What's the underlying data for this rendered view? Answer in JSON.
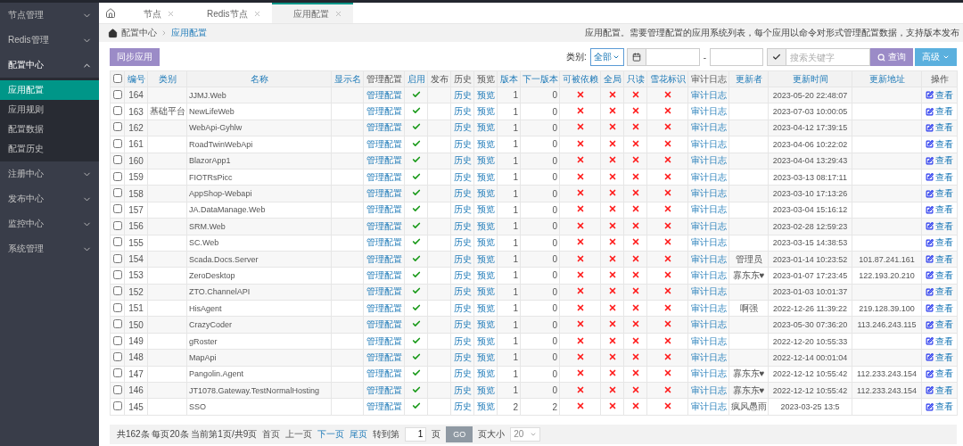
{
  "sidebar": {
    "items": [
      {
        "label": "节点管理",
        "expanded": false
      },
      {
        "label": "Redis管理",
        "expanded": false
      },
      {
        "label": "配置中心",
        "expanded": true,
        "children": [
          {
            "label": "应用配置",
            "selected": true
          },
          {
            "label": "应用规则",
            "selected": false
          },
          {
            "label": "配置数据",
            "selected": false
          },
          {
            "label": "配置历史",
            "selected": false
          }
        ]
      },
      {
        "label": "注册中心",
        "expanded": false
      },
      {
        "label": "发布中心",
        "expanded": false
      },
      {
        "label": "监控中心",
        "expanded": false
      },
      {
        "label": "系统管理",
        "expanded": false
      }
    ]
  },
  "tabs": [
    {
      "label": "节点",
      "selected": false
    },
    {
      "label": "Redis节点",
      "selected": false
    },
    {
      "label": "应用配置",
      "selected": true
    }
  ],
  "breadcrumb": {
    "items": [
      "配置中心",
      "应用配置"
    ],
    "description": "应用配置。需要管理配置的应用系统列表，每个应用以命令对形式管理配置数据，支持版本发布"
  },
  "toolbar": {
    "sync_button": "同步应用",
    "category_label": "类别:",
    "category_value": "全部",
    "date_separator": "-",
    "search_placeholder": "搜索关键字",
    "search_button": "查询",
    "advanced_button": "高级"
  },
  "table": {
    "select_all_checked": false,
    "columns": [
      {
        "label": "编号",
        "sortable": true
      },
      {
        "label": "类别",
        "sortable": true
      },
      {
        "label": "名称",
        "sortable": true
      },
      {
        "label": "显示名",
        "sortable": true
      },
      {
        "label": "管理配置",
        "sortable": false
      },
      {
        "label": "启用",
        "sortable": true
      },
      {
        "label": "发布",
        "sortable": false
      },
      {
        "label": "历史",
        "sortable": false
      },
      {
        "label": "预览",
        "sortable": false
      },
      {
        "label": "版本",
        "sortable": true
      },
      {
        "label": "下一版本",
        "sortable": true
      },
      {
        "label": "可被依赖",
        "sortable": true
      },
      {
        "label": "全局",
        "sortable": true
      },
      {
        "label": "只读",
        "sortable": true
      },
      {
        "label": "雪花标识",
        "sortable": true
      },
      {
        "label": "审计日志",
        "sortable": false
      },
      {
        "label": "更新者",
        "sortable": true
      },
      {
        "label": "更新时间",
        "sortable": true
      },
      {
        "label": "更新地址",
        "sortable": true
      },
      {
        "label": "操作",
        "sortable": false
      }
    ],
    "rows": [
      {
        "checked": false,
        "id": "164",
        "name": "JJMJ.Web",
        "manage": "管理配置",
        "enabled": true,
        "history": "历史",
        "preview": "预览",
        "version": "1",
        "next_version": "0",
        "dependable": false,
        "global": false,
        "readonly": false,
        "snowflake": false,
        "audit": "审计日志",
        "updated_at": "2023-05-20 22:48:07",
        "action": "查看"
      },
      {
        "checked": false,
        "id": "163",
        "category": "基础平台",
        "name": "NewLifeWeb",
        "manage": "管理配置",
        "enabled": true,
        "history": "历史",
        "preview": "预览",
        "version": "1",
        "next_version": "0",
        "dependable": false,
        "global": false,
        "readonly": false,
        "snowflake": false,
        "audit": "审计日志",
        "updated_at": "2023-07-03 10:00:05",
        "action": "查看"
      },
      {
        "checked": false,
        "id": "162",
        "name": "WebApi-Gyhlw",
        "manage": "管理配置",
        "enabled": true,
        "history": "历史",
        "preview": "预览",
        "version": "1",
        "next_version": "0",
        "dependable": false,
        "global": false,
        "readonly": false,
        "snowflake": false,
        "audit": "审计日志",
        "updated_at": "2023-04-12 17:39:15",
        "action": "查看"
      },
      {
        "checked": false,
        "id": "161",
        "name": "RoadTwinWebApi",
        "manage": "管理配置",
        "enabled": true,
        "history": "历史",
        "preview": "预览",
        "version": "1",
        "next_version": "0",
        "dependable": false,
        "global": false,
        "readonly": false,
        "snowflake": false,
        "audit": "审计日志",
        "updated_at": "2023-04-06 10:22:02",
        "action": "查看"
      },
      {
        "checked": false,
        "id": "160",
        "name": "BlazorApp1",
        "manage": "管理配置",
        "enabled": true,
        "history": "历史",
        "preview": "预览",
        "version": "1",
        "next_version": "0",
        "dependable": false,
        "global": false,
        "readonly": false,
        "snowflake": false,
        "audit": "审计日志",
        "updated_at": "2023-04-04 13:29:43",
        "action": "查看"
      },
      {
        "checked": false,
        "id": "159",
        "name": "FIOTRsPicc",
        "manage": "管理配置",
        "enabled": true,
        "history": "历史",
        "preview": "预览",
        "version": "1",
        "next_version": "0",
        "dependable": false,
        "global": false,
        "readonly": false,
        "snowflake": false,
        "audit": "审计日志",
        "updated_at": "2023-03-13 08:17:11",
        "action": "查看"
      },
      {
        "checked": false,
        "id": "158",
        "name": "AppShop-Webapi",
        "manage": "管理配置",
        "enabled": true,
        "history": "历史",
        "preview": "预览",
        "version": "1",
        "next_version": "0",
        "dependable": false,
        "global": false,
        "readonly": false,
        "snowflake": false,
        "audit": "审计日志",
        "updated_at": "2023-03-10 17:13:26",
        "action": "查看"
      },
      {
        "checked": false,
        "id": "157",
        "name": "JA.DataManage.Web",
        "manage": "管理配置",
        "enabled": true,
        "history": "历史",
        "preview": "预览",
        "version": "1",
        "next_version": "0",
        "dependable": false,
        "global": false,
        "readonly": false,
        "snowflake": false,
        "audit": "审计日志",
        "updated_at": "2023-03-04 15:16:12",
        "action": "查看"
      },
      {
        "checked": false,
        "id": "156",
        "name": "SRM.Web",
        "manage": "管理配置",
        "enabled": true,
        "history": "历史",
        "preview": "预览",
        "version": "1",
        "next_version": "0",
        "dependable": false,
        "global": false,
        "readonly": false,
        "snowflake": false,
        "audit": "审计日志",
        "updated_at": "2023-02-28 12:59:23",
        "action": "查看"
      },
      {
        "checked": false,
        "id": "155",
        "name": "SC.Web",
        "manage": "管理配置",
        "enabled": true,
        "history": "历史",
        "preview": "预览",
        "version": "1",
        "next_version": "0",
        "dependable": false,
        "global": false,
        "readonly": false,
        "snowflake": false,
        "audit": "审计日志",
        "updated_at": "2023-03-15 14:38:53",
        "action": "查看"
      },
      {
        "checked": false,
        "id": "154",
        "name": "Scada.Docs.Server",
        "manage": "管理配置",
        "enabled": true,
        "history": "历史",
        "preview": "预览",
        "version": "1",
        "next_version": "0",
        "dependable": false,
        "global": false,
        "readonly": false,
        "snowflake": false,
        "audit": "审计日志",
        "updater": "管理员",
        "updated_at": "2023-01-14 10:23:52",
        "updated_from": "101.87.241.161",
        "action": "查看"
      },
      {
        "checked": false,
        "id": "153",
        "name": "ZeroDesktop",
        "manage": "管理配置",
        "enabled": true,
        "history": "历史",
        "preview": "预览",
        "version": "1",
        "next_version": "0",
        "dependable": false,
        "global": false,
        "readonly": false,
        "snowflake": false,
        "audit": "审计日志",
        "updater": "寡东东♥",
        "updated_at": "2023-01-07 17:23:45",
        "updated_from": "122.193.20.210",
        "action": "查看"
      },
      {
        "checked": false,
        "id": "152",
        "name": "ZTO.ChannelAPI",
        "manage": "管理配置",
        "enabled": true,
        "history": "历史",
        "preview": "预览",
        "version": "1",
        "next_version": "0",
        "dependable": false,
        "global": false,
        "readonly": false,
        "snowflake": false,
        "audit": "审计日志",
        "updated_at": "2023-01-03 10:01:37",
        "action": "查看"
      },
      {
        "checked": false,
        "id": "151",
        "name": "HisAgent",
        "manage": "管理配置",
        "enabled": true,
        "history": "历史",
        "preview": "预览",
        "version": "1",
        "next_version": "0",
        "dependable": false,
        "global": false,
        "readonly": false,
        "snowflake": false,
        "audit": "审计日志",
        "updater": "啊强",
        "updated_at": "2022-12-26 11:39:22",
        "updated_from": "219.128.39.100",
        "action": "查看"
      },
      {
        "checked": false,
        "id": "150",
        "name": "CrazyCoder",
        "manage": "管理配置",
        "enabled": true,
        "history": "历史",
        "preview": "预览",
        "version": "1",
        "next_version": "0",
        "dependable": false,
        "global": false,
        "readonly": false,
        "snowflake": false,
        "audit": "审计日志",
        "updated_at": "2023-05-30 07:36:20",
        "updated_from": "113.246.243.115",
        "action": "查看"
      },
      {
        "checked": false,
        "id": "149",
        "name": "gRoster",
        "manage": "管理配置",
        "enabled": true,
        "history": "历史",
        "preview": "预览",
        "version": "1",
        "next_version": "0",
        "dependable": false,
        "global": false,
        "readonly": false,
        "snowflake": false,
        "audit": "审计日志",
        "updated_at": "2022-12-20 10:55:33",
        "action": "查看"
      },
      {
        "checked": false,
        "id": "148",
        "name": "MapApi",
        "manage": "管理配置",
        "enabled": true,
        "history": "历史",
        "preview": "预览",
        "version": "1",
        "next_version": "0",
        "dependable": false,
        "global": false,
        "readonly": false,
        "snowflake": false,
        "audit": "审计日志",
        "updated_at": "2022-12-14 00:01:04",
        "action": "查看"
      },
      {
        "checked": false,
        "id": "147",
        "name": "Pangolin.Agent",
        "manage": "管理配置",
        "enabled": true,
        "history": "历史",
        "preview": "预览",
        "version": "1",
        "next_version": "0",
        "dependable": false,
        "global": false,
        "readonly": false,
        "snowflake": false,
        "audit": "审计日志",
        "updater": "寡东东♥",
        "updated_at": "2022-12-12 10:55:42",
        "updated_from": "112.233.243.154",
        "action": "查看"
      },
      {
        "checked": false,
        "id": "146",
        "name": "JT1078.Gateway.TestNormalHosting",
        "manage": "管理配置",
        "enabled": true,
        "history": "历史",
        "preview": "预览",
        "version": "1",
        "next_version": "0",
        "dependable": false,
        "global": false,
        "readonly": false,
        "snowflake": false,
        "audit": "审计日志",
        "updater": "寡东东♥",
        "updated_at": "2022-12-12 10:55:42",
        "updated_from": "112.233.243.154",
        "action": "查看"
      },
      {
        "checked": false,
        "id": "145",
        "name": "SSO",
        "manage": "管理配置",
        "enabled": true,
        "history": "历史",
        "preview": "预览",
        "version": "2",
        "next_version": "2",
        "dependable": false,
        "global": false,
        "readonly": false,
        "snowflake": false,
        "audit": "审计日志",
        "updater": "疯风愚雨",
        "updated_at": "2023-03-25 13:5",
        "action": "查看"
      }
    ]
  },
  "pagination": {
    "summary": "共162条 每页20条 当前第1页/共9页",
    "links": [
      {
        "label": "首页",
        "disabled": true
      },
      {
        "label": "上一页",
        "disabled": true
      },
      {
        "label": "下一页",
        "disabled": false
      },
      {
        "label": "尾页",
        "disabled": false
      }
    ],
    "goto_label": "转到第",
    "page_value": "1",
    "page_unit": "页",
    "go_button": "GO",
    "size_label": "页大小",
    "size_value": "20"
  }
}
